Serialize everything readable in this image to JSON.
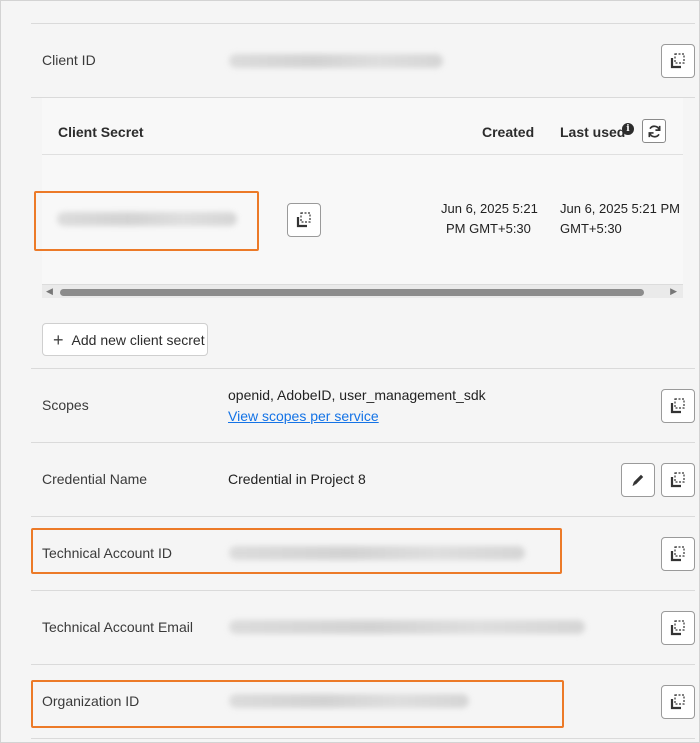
{
  "rows": {
    "client_id": {
      "label": "Client ID"
    },
    "client_secret": {
      "header_secret": "Client Secret",
      "header_created": "Created",
      "header_last_used": "Last used",
      "created_line1": "Jun 6, 2025 5:21",
      "created_line2": "PM GMT+5:30",
      "last_used_line1": "Jun 6, 2025 5:21 PM",
      "last_used_line2": "GMT+5:30"
    },
    "add_secret_label": "Add new client secret",
    "scopes": {
      "label": "Scopes",
      "value": "openid, AdobeID, user_management_sdk",
      "link": "View scopes per service"
    },
    "credential_name": {
      "label": "Credential Name",
      "value": "Credential in Project 8"
    },
    "technical_account_id": {
      "label": "Technical Account ID"
    },
    "technical_account_email": {
      "label": "Technical Account Email"
    },
    "organization_id": {
      "label": "Organization ID"
    }
  },
  "icons": {
    "copy": "copy-icon",
    "refresh": "refresh-icon",
    "info": "info-icon",
    "edit": "pencil-icon",
    "add": "plus-icon"
  },
  "colors": {
    "highlight": "#ec7a28",
    "link": "#1473e6"
  }
}
